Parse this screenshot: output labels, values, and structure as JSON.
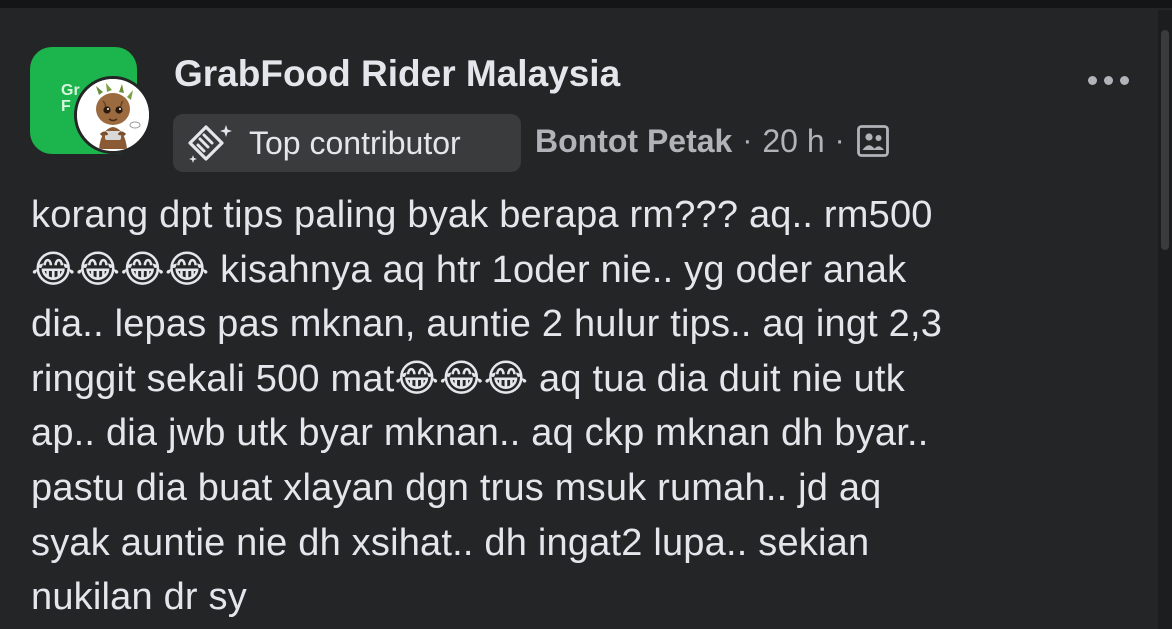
{
  "post": {
    "group_name": "GrabFood Rider Malaysia",
    "group_logo_text": "Gr\nF",
    "badge_label": "Top contributor",
    "author": "Bontot Petak",
    "separator": "·",
    "time": "20 h",
    "audience_icon": "group-audience-icon",
    "body": "korang dpt tips paling byak berapa rm??? aq.. rm500\n😂😂😂😂 kisahnya aq htr 1oder nie.. yg oder anak\ndia.. lepas pas mknan, auntie 2 hulur tips.. aq ingt 2,3\nringgit sekali 500 mat😂😂😂 aq tua dia duit nie utk\nap.. dia jwb utk byar mknan.. aq ckp mknan dh byar..\npastu dia buat xlayan dgn trus msuk rumah.. jd aq\nsyak auntie nie dh xsihat.. dh ingat2 lupa.. sekian\nnukilan dr sy"
  },
  "colors": {
    "background": "#242526",
    "logo_green": "#1cb44c",
    "text_primary": "#e4e6eb",
    "text_secondary": "#b0b3b8",
    "badge_bg": "#3a3b3c"
  }
}
